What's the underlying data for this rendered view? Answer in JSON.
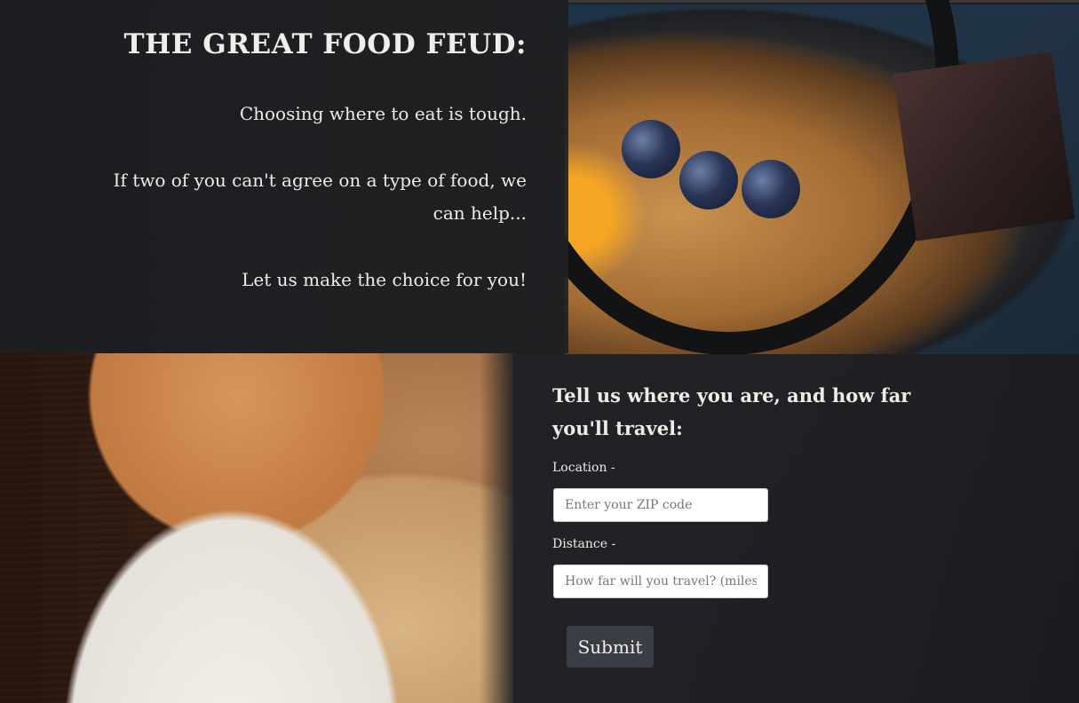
{
  "hero": {
    "title": "THE GREAT FOOD FEUD:",
    "paragraphs": [
      "Choosing where to eat is tough.",
      "If two of you can't agree on a type of food, we can help...",
      "Let us make the choice for you!"
    ]
  },
  "form": {
    "heading": "Tell us where you are, and how far you'll travel:",
    "location_label": "Location -",
    "location_placeholder": "Enter your ZIP code",
    "distance_label": "Distance -",
    "distance_placeholder": "How far will you travel? (miles)",
    "submit_label": "Submit"
  },
  "colors": {
    "panel": "#1e2024",
    "text": "#efece6",
    "button": "#3a3d45"
  }
}
